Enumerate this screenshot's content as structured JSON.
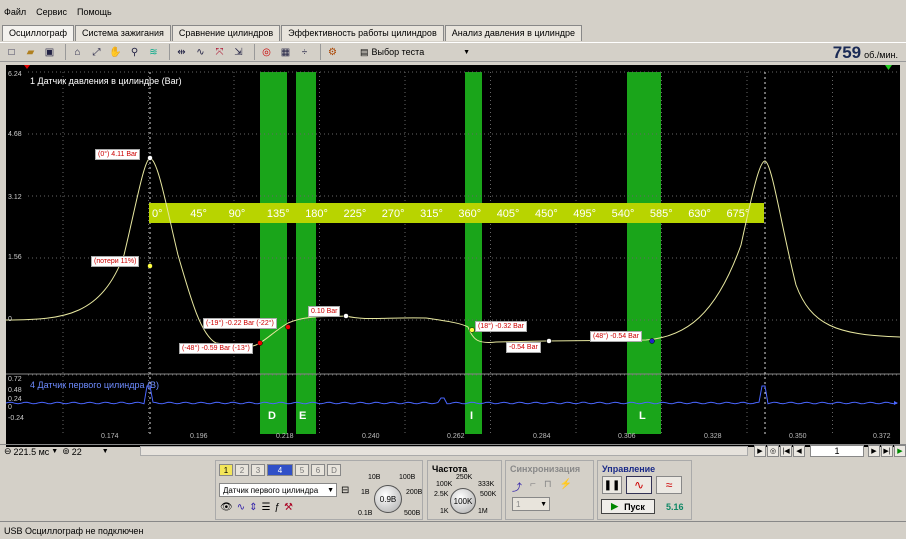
{
  "menu": [
    "Файл",
    "Сервис",
    "Помощь"
  ],
  "tabs": [
    {
      "label": "Осциллограф",
      "active": true
    },
    {
      "label": "Система зажигания"
    },
    {
      "label": "Сравнение цилиндров"
    },
    {
      "label": "Эффективность работы цилиндров"
    },
    {
      "label": "Анализ давления в цилиндре"
    }
  ],
  "toolbar": {
    "icons": [
      "new-icon",
      "open-icon",
      "save-icon",
      "cursor-icon",
      "zoom-fit-icon",
      "hand-icon",
      "zoom-icon",
      "stack-icon",
      "scale-icon",
      "wave-icon",
      "expand-icon",
      "compress-icon",
      "record-icon",
      "table-icon",
      "split-icon",
      "settings-icon"
    ],
    "test_select_label": "Выбор теста",
    "rpm_value": "759",
    "rpm_unit": "об./мин."
  },
  "scope": {
    "channel1_label": "1 Датчик давления в цилиндре (Bar)",
    "channel4_label": "4 Датчик первого цилиндра (В)",
    "y_labels": [
      "6.24",
      "4.68",
      "3.12",
      "1.56",
      "0"
    ],
    "y2_labels": [
      "0.72",
      "0.48",
      "0.24",
      "0",
      "-0.24"
    ],
    "x_labels": [
      "0.174",
      "0.196",
      "0.218",
      "0.240",
      "0.262",
      "0.284",
      "0.306",
      "0.328",
      "0.350",
      "0.372"
    ],
    "degree_scale": [
      "0°",
      "45°",
      "90°",
      "135°",
      "180°",
      "225°",
      "270°",
      "315°",
      "360°",
      "405°",
      "450°",
      "495°",
      "540°",
      "585°",
      "630°",
      "675°"
    ],
    "bands": [
      "D",
      "E",
      "I",
      "L"
    ],
    "markers": {
      "peak": "(0°) 4.11 Bar",
      "loss": "(потери 11%)",
      "m1": "(-19°) -0.22 Bar (-22°)",
      "m2": "(-48°) -0.59 Bar (-13°)",
      "m3": "0.10 Bar",
      "m4": "(18°) -0.32 Bar",
      "m5": "-0.54 Bar",
      "m6": "(48°) -0.54 Bar"
    },
    "colors": {
      "trace1": "#e8e8a0",
      "trace2": "#4a66ff",
      "band": "#1aa51a",
      "scale": "#b8d400"
    }
  },
  "nav": {
    "timebase": "221.5 мс",
    "divisions": "22",
    "page": "1"
  },
  "channels_panel": {
    "buttons": [
      "1",
      "2",
      "3",
      "4",
      "5",
      "6",
      "D"
    ],
    "selected": "4",
    "sensor": "Датчик первого цилиндра",
    "range_labels": [
      "10В",
      "100В",
      "1В",
      "200В",
      "0.1В",
      "500В"
    ],
    "range_value": "0.9В"
  },
  "freq_panel": {
    "title": "Частота",
    "labels": [
      "250K",
      "100K",
      "333K",
      "2.5K",
      "500K",
      "1K",
      "1M"
    ],
    "value": "100K"
  },
  "sync_panel": {
    "title": "Синхронизация",
    "channel": "1"
  },
  "control_panel": {
    "title": "Управление",
    "run_label": "Пуск",
    "value": "5.16"
  },
  "status": "USB Осциллограф не подключен"
}
